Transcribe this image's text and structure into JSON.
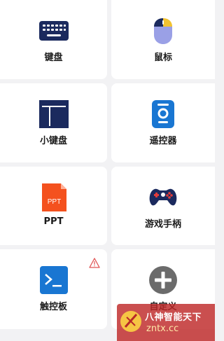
{
  "tiles": [
    {
      "label": "键盘",
      "icon": "keyboard-icon"
    },
    {
      "label": "鼠标",
      "icon": "mouse-icon"
    },
    {
      "label": "小键盘",
      "icon": "numpad-icon"
    },
    {
      "label": "遥控器",
      "icon": "remote-control-icon"
    },
    {
      "label": "PPT",
      "icon": "ppt-file-icon"
    },
    {
      "label": "游戏手柄",
      "icon": "gamepad-icon"
    },
    {
      "label": "触控板",
      "icon": "touchpad-terminal-icon",
      "warning_icon": "warning-icon"
    },
    {
      "label": "自定义",
      "icon": "add-circle-icon"
    }
  ],
  "ppt_icon_text": "PPT",
  "watermark": {
    "line1": "八神智能天下",
    "line2": "zntx.cc"
  },
  "colors": {
    "background": "#f2f2f4",
    "card": "#ffffff",
    "navy": "#1b2a5e",
    "blue": "#1976d2",
    "orange": "#f4511e",
    "yellow": "#f2c230",
    "lavender": "#9aa0e6",
    "gray": "#6b6b6b",
    "warning": "#e05555"
  }
}
